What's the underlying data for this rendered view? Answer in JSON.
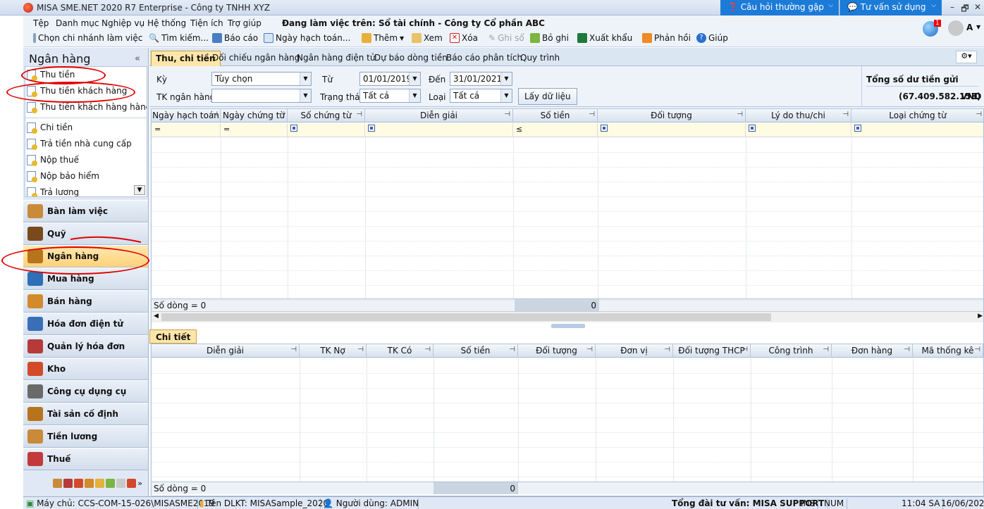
{
  "title": "MISA SME.NET 2020 R7 Enterprise - Công ty TNHH XYZ",
  "help": {
    "faq": "Câu hỏi thường gặp",
    "advice": "Tư vấn sử dụng"
  },
  "window": {
    "min": "–",
    "restore": "🗗",
    "close": "✕"
  },
  "menu": [
    "Tệp",
    "Danh mục",
    "Nghiệp vụ",
    "Hệ thống",
    "Tiện ích",
    "Trợ giúp"
  ],
  "workspace": "Đang làm việc trên: Sổ tài chính - Công ty Cổ phần ABC",
  "toolbar": {
    "branch": "Chọn chi nhánh làm việc",
    "search": "Tìm kiếm...",
    "report": "Báo cáo",
    "posting_date": "Ngày hạch toán...",
    "add": "Thêm",
    "view": "Xem",
    "delete": "Xóa",
    "post": "Ghi sổ",
    "unpost": "Bỏ ghi",
    "export": "Xuất khẩu",
    "feedback": "Phản hồi",
    "help": "Giúp",
    "user": "A",
    "notif": "1"
  },
  "left_panel": {
    "title": "Ngân hàng",
    "collapse": "«",
    "items": [
      "Thu tiền",
      "Thu tiền khách hàng",
      "Thu tiền khách hàng hàng l...",
      "Chi tiền",
      "Trả tiền nhà cung cấp",
      "Nộp thuế",
      "Nộp bảo hiểm",
      "Trả lương"
    ],
    "nav": [
      "Bàn làm việc",
      "Quỹ",
      "Ngân hàng",
      "Mua hàng",
      "Bán hàng",
      "Hóa đơn điện tử",
      "Quản lý hóa đơn",
      "Kho",
      "Công cụ dụng cụ",
      "Tài sản cố định",
      "Tiền lương",
      "Thuế"
    ],
    "nav_colors": [
      "#c98a3a",
      "#7a4a1e",
      "#b8741d",
      "#2e6fb5",
      "#d28a2b",
      "#3a6fb8",
      "#b73a3a",
      "#d24a2a",
      "#6a6a6a",
      "#b8741d",
      "#c98a3a",
      "#c23a3a"
    ],
    "active_nav": "Ngân hàng"
  },
  "tabs": [
    "Thu, chi tiền",
    "Đối chiếu ngân hàng",
    "Ngân hàng điện tử",
    "Dự báo dòng tiền",
    "Báo cáo phân tích",
    "Quy trình"
  ],
  "filter": {
    "period_label": "Kỳ",
    "period_value": "Tùy chọn",
    "from_label": "Từ",
    "from_value": "01/01/2019",
    "to_label": "Đến",
    "to_value": "31/01/2021",
    "account_label": "TK ngân hàng",
    "account_value": "",
    "status_label": "Trạng thái",
    "status_value": "Tất cả",
    "type_label": "Loại",
    "type_value": "Tất cả",
    "fetch": "Lấy dữ liệu"
  },
  "summary": {
    "label": "Tổng số dư tiền gửi",
    "value": "(67.409.582.153)",
    "currency": "VND"
  },
  "grid": {
    "columns": [
      "Ngày hạch toán",
      "Ngày chứng từ",
      "Số chứng từ",
      "Diễn giải",
      "Số tiền",
      "Đối tượng",
      "Lý do thu/chi",
      "Loại chứng từ"
    ],
    "filters": [
      "=",
      "=",
      "",
      "",
      "≤",
      "",
      "",
      ""
    ],
    "row_count": "Số dòng = 0",
    "total": "0"
  },
  "detail": {
    "tab": "Chi tiết",
    "columns": [
      "Diễn giải",
      "TK Nợ",
      "TK Có",
      "Số tiền",
      "Đối tượng",
      "Đơn vị",
      "Đối tượng THCP",
      "Công trình",
      "Đơn hàng",
      "Mã thống kê"
    ],
    "row_count": "Số dòng = 0",
    "total": "0"
  },
  "status": {
    "server": "Máy chủ: CCS-COM-15-026\\MISASME2019",
    "db": "Tên DLKT: MISASample_2020",
    "user": "Người dùng: ADMIN",
    "hotline": "Tổng đài tư vấn: MISA SUPPORT",
    "ins": "INS",
    "num": "NUM",
    "time": "11:04 SA",
    "date": "16/06/2020"
  }
}
